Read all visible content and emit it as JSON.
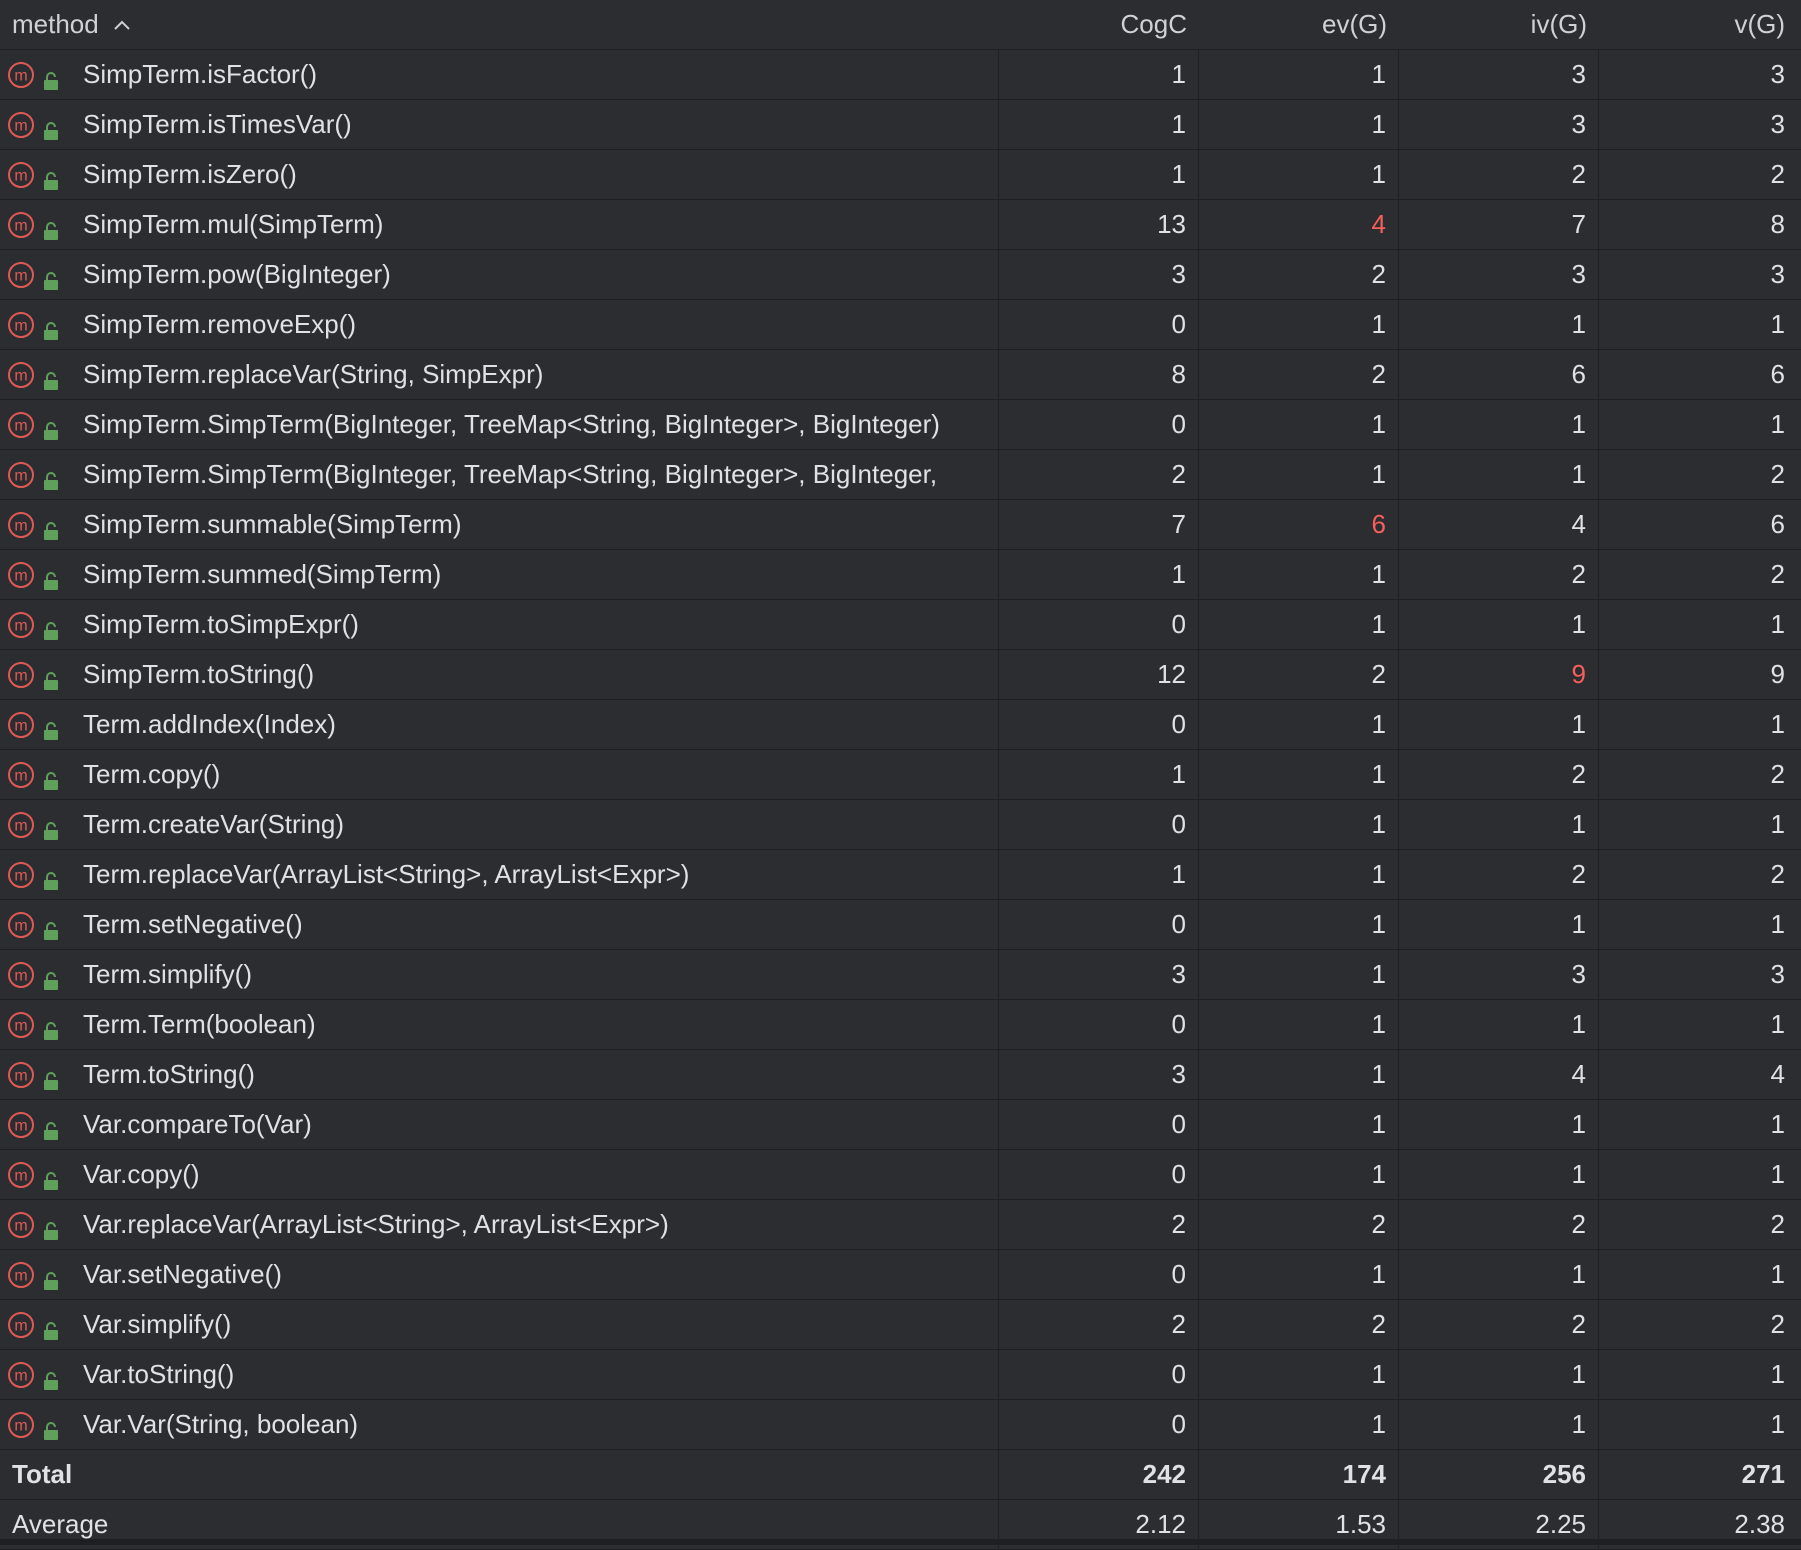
{
  "columns": {
    "method": "method",
    "cogc": "CogC",
    "ev": "ev(G)",
    "iv": "iv(G)",
    "v": "v(G)"
  },
  "sort": {
    "column": "method",
    "direction": "ascending",
    "icon": "chevron-up-icon"
  },
  "row_icons": {
    "method_icon": "method-m-icon",
    "access_icon": "public-lock-icon"
  },
  "colors": {
    "background": "#2b2d30",
    "text": "#dfe1e5",
    "highlight": "#f75f5a",
    "method_icon": "#e05a55",
    "lock_icon": "#5fa05a"
  },
  "rows": [
    {
      "method": "SimpTerm.isFactor()",
      "cogc": "1",
      "ev": "1",
      "iv": "3",
      "v": "3",
      "highlight": []
    },
    {
      "method": "SimpTerm.isTimesVar()",
      "cogc": "1",
      "ev": "1",
      "iv": "3",
      "v": "3",
      "highlight": []
    },
    {
      "method": "SimpTerm.isZero()",
      "cogc": "1",
      "ev": "1",
      "iv": "2",
      "v": "2",
      "highlight": []
    },
    {
      "method": "SimpTerm.mul(SimpTerm)",
      "cogc": "13",
      "ev": "4",
      "iv": "7",
      "v": "8",
      "highlight": [
        "ev"
      ]
    },
    {
      "method": "SimpTerm.pow(BigInteger)",
      "cogc": "3",
      "ev": "2",
      "iv": "3",
      "v": "3",
      "highlight": []
    },
    {
      "method": "SimpTerm.removeExp()",
      "cogc": "0",
      "ev": "1",
      "iv": "1",
      "v": "1",
      "highlight": []
    },
    {
      "method": "SimpTerm.replaceVar(String, SimpExpr)",
      "cogc": "8",
      "ev": "2",
      "iv": "6",
      "v": "6",
      "highlight": []
    },
    {
      "method": "SimpTerm.SimpTerm(BigInteger, TreeMap<String, BigInteger>, BigInteger)",
      "cogc": "0",
      "ev": "1",
      "iv": "1",
      "v": "1",
      "highlight": []
    },
    {
      "method": "SimpTerm.SimpTerm(BigInteger, TreeMap<String, BigInteger>, BigInteger,",
      "cogc": "2",
      "ev": "1",
      "iv": "1",
      "v": "2",
      "highlight": []
    },
    {
      "method": "SimpTerm.summable(SimpTerm)",
      "cogc": "7",
      "ev": "6",
      "iv": "4",
      "v": "6",
      "highlight": [
        "ev"
      ]
    },
    {
      "method": "SimpTerm.summed(SimpTerm)",
      "cogc": "1",
      "ev": "1",
      "iv": "2",
      "v": "2",
      "highlight": []
    },
    {
      "method": "SimpTerm.toSimpExpr()",
      "cogc": "0",
      "ev": "1",
      "iv": "1",
      "v": "1",
      "highlight": []
    },
    {
      "method": "SimpTerm.toString()",
      "cogc": "12",
      "ev": "2",
      "iv": "9",
      "v": "9",
      "highlight": [
        "iv"
      ]
    },
    {
      "method": "Term.addIndex(Index)",
      "cogc": "0",
      "ev": "1",
      "iv": "1",
      "v": "1",
      "highlight": []
    },
    {
      "method": "Term.copy()",
      "cogc": "1",
      "ev": "1",
      "iv": "2",
      "v": "2",
      "highlight": []
    },
    {
      "method": "Term.createVar(String)",
      "cogc": "0",
      "ev": "1",
      "iv": "1",
      "v": "1",
      "highlight": []
    },
    {
      "method": "Term.replaceVar(ArrayList<String>, ArrayList<Expr>)",
      "cogc": "1",
      "ev": "1",
      "iv": "2",
      "v": "2",
      "highlight": []
    },
    {
      "method": "Term.setNegative()",
      "cogc": "0",
      "ev": "1",
      "iv": "1",
      "v": "1",
      "highlight": []
    },
    {
      "method": "Term.simplify()",
      "cogc": "3",
      "ev": "1",
      "iv": "3",
      "v": "3",
      "highlight": []
    },
    {
      "method": "Term.Term(boolean)",
      "cogc": "0",
      "ev": "1",
      "iv": "1",
      "v": "1",
      "highlight": []
    },
    {
      "method": "Term.toString()",
      "cogc": "3",
      "ev": "1",
      "iv": "4",
      "v": "4",
      "highlight": []
    },
    {
      "method": "Var.compareTo(Var)",
      "cogc": "0",
      "ev": "1",
      "iv": "1",
      "v": "1",
      "highlight": []
    },
    {
      "method": "Var.copy()",
      "cogc": "0",
      "ev": "1",
      "iv": "1",
      "v": "1",
      "highlight": []
    },
    {
      "method": "Var.replaceVar(ArrayList<String>, ArrayList<Expr>)",
      "cogc": "2",
      "ev": "2",
      "iv": "2",
      "v": "2",
      "highlight": []
    },
    {
      "method": "Var.setNegative()",
      "cogc": "0",
      "ev": "1",
      "iv": "1",
      "v": "1",
      "highlight": []
    },
    {
      "method": "Var.simplify()",
      "cogc": "2",
      "ev": "2",
      "iv": "2",
      "v": "2",
      "highlight": []
    },
    {
      "method": "Var.toString()",
      "cogc": "0",
      "ev": "1",
      "iv": "1",
      "v": "1",
      "highlight": []
    },
    {
      "method": "Var.Var(String, boolean)",
      "cogc": "0",
      "ev": "1",
      "iv": "1",
      "v": "1",
      "highlight": []
    }
  ],
  "total": {
    "label": "Total",
    "cogc": "242",
    "ev": "174",
    "iv": "256",
    "v": "271"
  },
  "average": {
    "label": "Average",
    "cogc": "2.12",
    "ev": "1.53",
    "iv": "2.25",
    "v": "2.38"
  }
}
